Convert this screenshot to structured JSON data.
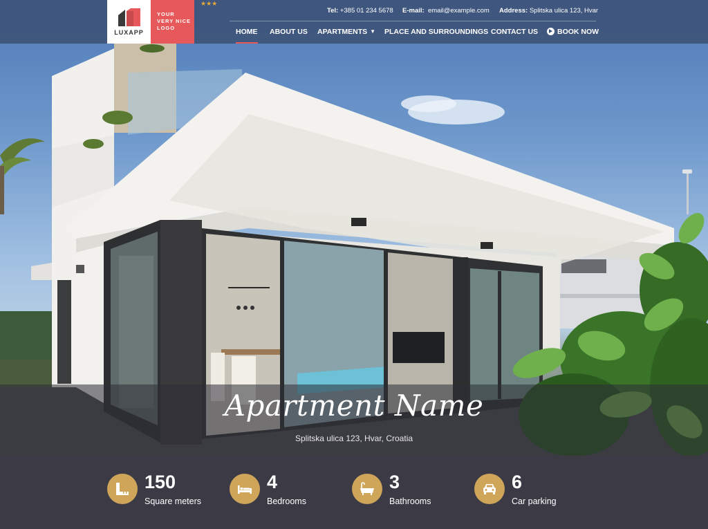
{
  "brand": {
    "logo_text": "LUXAPP",
    "tagline_lines": [
      "YOUR",
      "VERY NICE",
      "LOGO"
    ],
    "stars": "★★★",
    "accent_color": "#e6585a",
    "gold_color": "#cfa55a"
  },
  "contact": {
    "tel_label": "Tel:",
    "tel_value": "+385 01 234 5678",
    "email_label": "E-mail:",
    "email_value": "email@example.com",
    "address_label": "Address:",
    "address_value": "Splitska ulica 123, Hvar"
  },
  "nav": {
    "home": "HOME",
    "about": "ABOUT US",
    "apartments": "APARTMENTS",
    "place": "PLACE AND SURROUNDINGS",
    "contact": "CONTACT US",
    "book": "BOOK NOW",
    "active": "home"
  },
  "hero": {
    "title": "Apartment Name",
    "address": "Splitska ulica 123, Hvar, Croatia"
  },
  "stats": [
    {
      "icon": "ruler-icon",
      "value": "150",
      "label": "Square meters"
    },
    {
      "icon": "bed-icon",
      "value": "4",
      "label": "Bedrooms"
    },
    {
      "icon": "bathtub-icon",
      "value": "3",
      "label": "Bathrooms"
    },
    {
      "icon": "car-icon",
      "value": "6",
      "label": "Car parking"
    }
  ]
}
